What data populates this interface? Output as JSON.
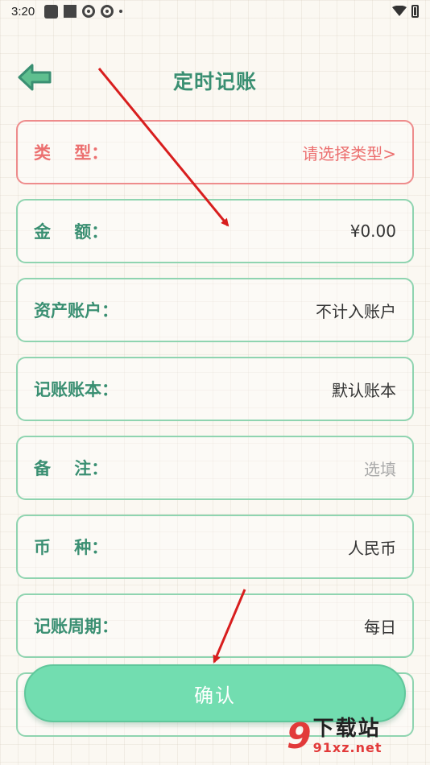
{
  "status_bar": {
    "time": "3:20"
  },
  "header": {
    "title": "定时记账",
    "back_icon": "back-arrow-icon"
  },
  "form": {
    "rows": [
      {
        "label": "类    型：",
        "value": "请选择类型>",
        "state": "error"
      },
      {
        "label": "金    额：",
        "value": "¥0.00"
      },
      {
        "label": "资产账户：",
        "value": "不计入账户"
      },
      {
        "label": "记账账本：",
        "value": "默认账本"
      },
      {
        "label": "备    注：",
        "value": "选填",
        "placeholder": true
      },
      {
        "label": "币    种：",
        "value": "人民币"
      },
      {
        "label": "记账周期：",
        "value": "每日"
      }
    ]
  },
  "confirm": {
    "label": "确认"
  },
  "watermark": {
    "logo": "9",
    "site_name": "下载站",
    "url": "91xz.net"
  },
  "colors": {
    "accent": "#3a8f72",
    "border": "#8fd4b0",
    "error": "#ec7070",
    "button": "#72ddb0",
    "annotation_arrow": "#d81e1e"
  }
}
